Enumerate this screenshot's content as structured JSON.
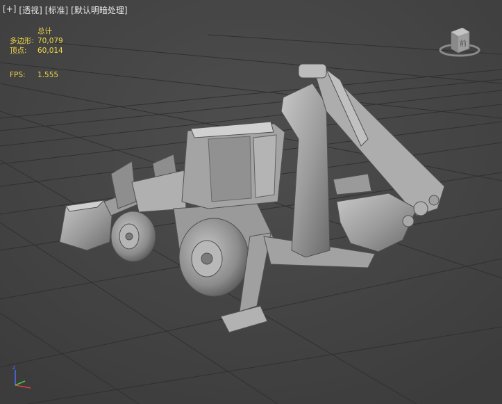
{
  "viewport": {
    "menu": {
      "plus": "[+]",
      "view": "[透视]",
      "shading": "[标准]",
      "lighting": "[默认明暗处理]"
    },
    "stats": {
      "header": "总计",
      "polygons_label": "多边形:",
      "polygons_value": "70,079",
      "vertices_label": "顶点:",
      "vertices_value": "60,014",
      "fps_label": "FPS:",
      "fps_value": "1.555"
    },
    "viewcube": {
      "face_label": "前"
    },
    "gizmo": {
      "axis_z": "z"
    },
    "colors": {
      "background": "#444444",
      "grid": "#303030",
      "stats_text": "#f0d74a",
      "menu_text": "#e6e6e6",
      "model": "#a9a9a9"
    }
  }
}
